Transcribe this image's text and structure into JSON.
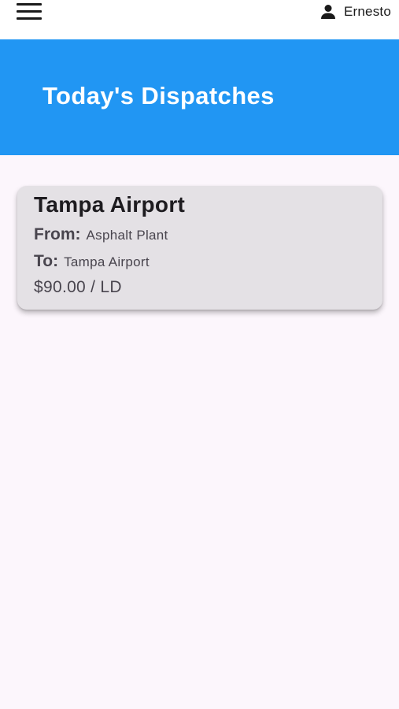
{
  "header": {
    "menu_icon": "hamburger-menu-icon",
    "user_icon": "person-icon",
    "user_name": "Ernesto"
  },
  "banner": {
    "title": "Today's Dispatches",
    "color": "#2196F3"
  },
  "dispatches": [
    {
      "title": "Tampa Airport",
      "from_label": "From:",
      "from_value": "Asphalt Plant",
      "to_label": "To:",
      "to_value": "Tampa Airport",
      "rate": "$90.00 / LD"
    }
  ]
}
